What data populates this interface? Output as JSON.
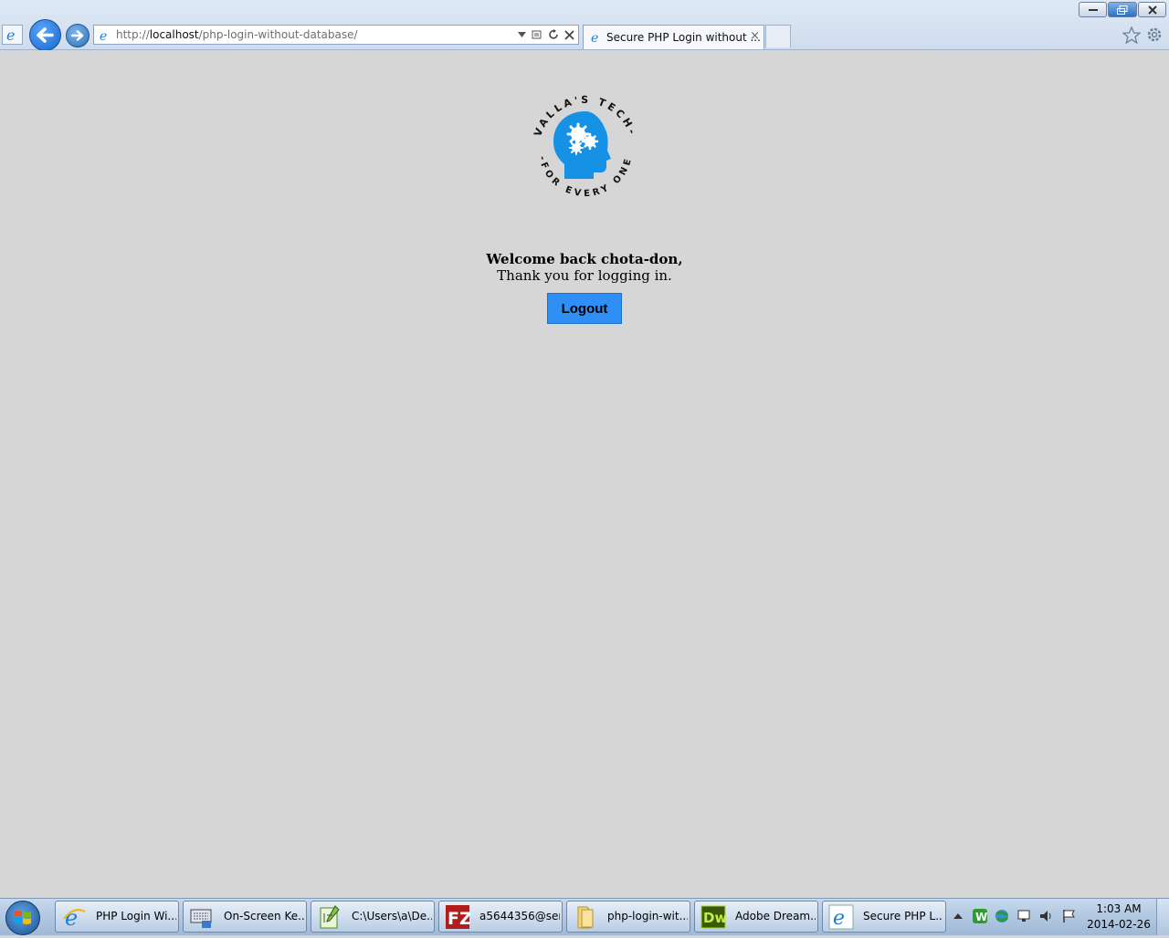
{
  "browser": {
    "url_prefix": "http://",
    "url_host": "localhost",
    "url_path": "/php-login-without-database/",
    "tab_title": "Secure PHP Login without ...",
    "tab_close": "×"
  },
  "page": {
    "logo": {
      "brand_text_top": "VALLA'S TECH",
      "brand_text_bottom": "- FOR EVERY ONE -",
      "accent_color": "#1592e6"
    },
    "welcome_line1": "Welcome back chota-don,",
    "welcome_line2": "Thank you for logging in.",
    "logout_label": "Logout",
    "button_color": "#2f8ff5",
    "background_color": "#d6d6d6"
  },
  "taskbar": {
    "items": [
      {
        "label": "PHP Login Wi...",
        "icon": "ie-icon"
      },
      {
        "label": "On-Screen Ke...",
        "icon": "keyboard-icon"
      },
      {
        "label": "C:\\Users\\a\\De...",
        "icon": "notepad-icon"
      },
      {
        "label": "a5644356@ser...",
        "icon": "filezilla-icon"
      },
      {
        "label": "php-login-wit...",
        "icon": "folder-icon"
      },
      {
        "label": "Adobe Dream...",
        "icon": "dreamweaver-icon"
      },
      {
        "label": "Secure PHP L...",
        "icon": "ie-icon"
      }
    ],
    "clock_time": "1:03 AM",
    "clock_date": "2014-02-26"
  }
}
